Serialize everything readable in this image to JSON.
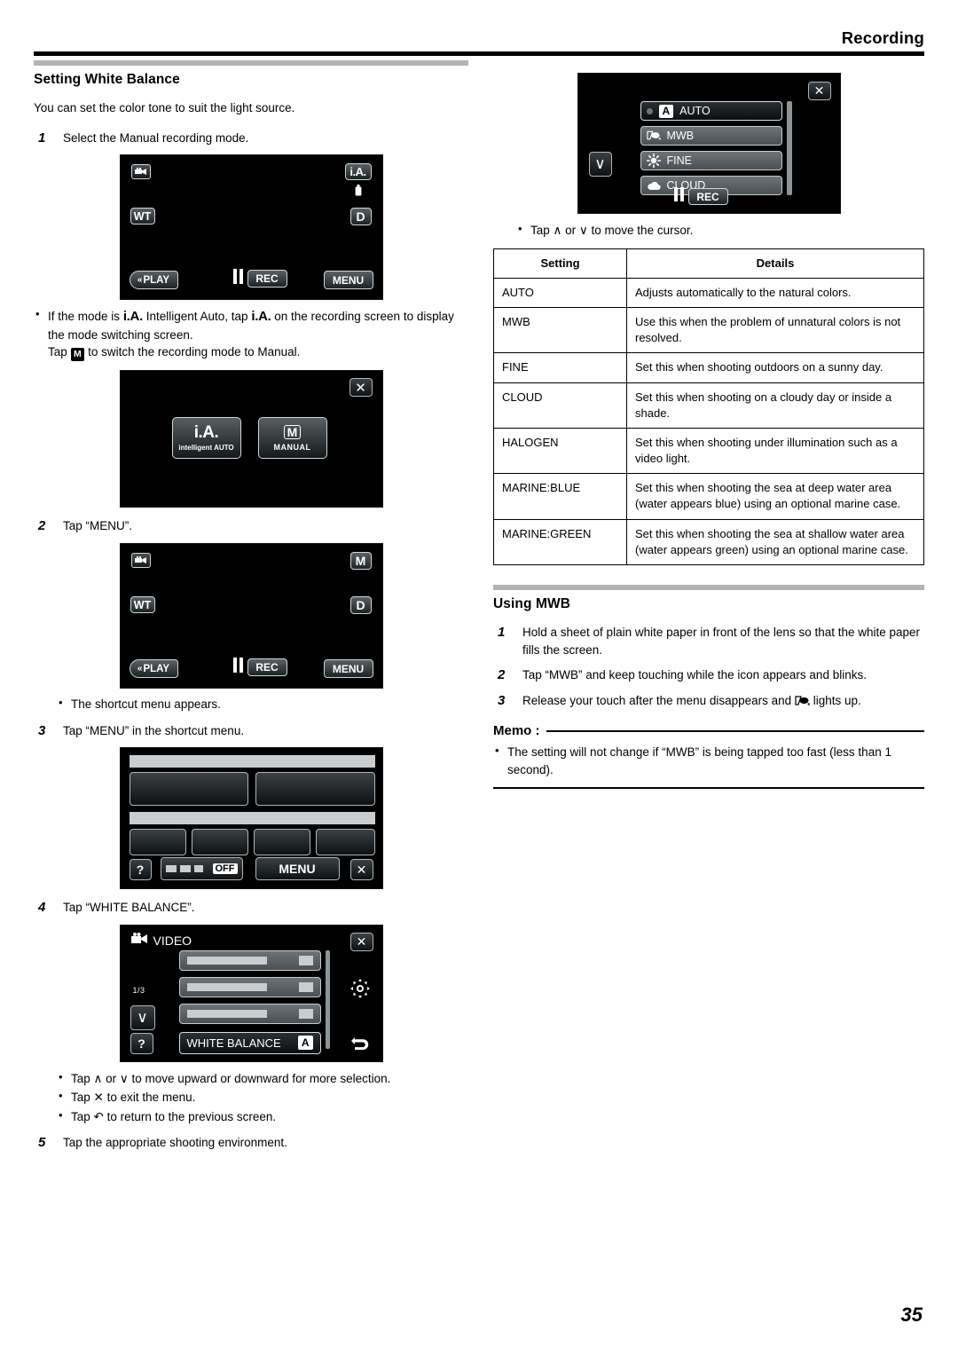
{
  "header": {
    "title": "Recording"
  },
  "page_number": "35",
  "left": {
    "section_title": "Setting White Balance",
    "intro": "You can set the color tone to suit the light source.",
    "step1": {
      "num": "1",
      "text": "Select the Manual recording mode."
    },
    "screen1": {
      "name": "recording-screen-ia",
      "camera_icon": "video-camera-icon",
      "mode_label": "i.A.",
      "zoom_label": "WT",
      "d_label": "D",
      "play_label": "PLAY",
      "rec_label": "REC",
      "menu_label": "MENU"
    },
    "note1_a": "If the mode is",
    "note1_b": "Intelligent Auto, tap",
    "note1_c": "on the recording screen to display the mode switching screen.",
    "note1_d": "Tap",
    "note1_e": "to switch the recording mode to Manual.",
    "note1_ia": "i.A.",
    "note1_m": "M",
    "screen2": {
      "name": "mode-switch-screen",
      "close_label": "✕",
      "auto_big": "i.A.",
      "auto_sub": "intelligent AUTO",
      "manual_big": "M",
      "manual_sub": "MANUAL"
    },
    "step2": {
      "num": "2",
      "text": "Tap “MENU”."
    },
    "screen3": {
      "name": "recording-screen-manual",
      "mode_label": "M",
      "zoom_label": "WT",
      "d_label": "D",
      "play_label": "PLAY",
      "rec_label": "REC",
      "menu_label": "MENU"
    },
    "note2": "The shortcut menu appears.",
    "step3": {
      "num": "3",
      "text": "Tap “MENU” in the shortcut menu."
    },
    "screen4": {
      "name": "shortcut-menu-screen",
      "help_label": "?",
      "off_label": "OFF",
      "menu_label": "MENU",
      "close_label": "✕"
    },
    "step4": {
      "num": "4",
      "text": "Tap “WHITE BALANCE”."
    },
    "screen5": {
      "name": "video-menu-screen",
      "title": "VIDEO",
      "close_label": "✕",
      "page_indicator": "1/3",
      "down_label": "∨",
      "help_label": "?",
      "white_balance_label": "WHITE BALANCE",
      "white_balance_value": "A",
      "gear_icon": "gear-icon",
      "back_icon": "back-arrow-icon"
    },
    "notes2": [
      "Tap ∧ or ∨ to move upward or downward for more selection.",
      "Tap ✕ to exit the menu.",
      "Tap ↶ to return to the previous screen."
    ],
    "step5": {
      "num": "5",
      "text": "Tap the appropriate shooting environment."
    }
  },
  "right": {
    "screen6": {
      "name": "white-balance-options-screen",
      "close_label": "✕",
      "down_label": "∨",
      "rec_label": "REC",
      "options": [
        {
          "label": "AUTO",
          "icon": "auto-a-icon",
          "selected": true
        },
        {
          "label": "MWB",
          "icon": "mwb-hand-paper-icon",
          "selected": false
        },
        {
          "label": "FINE",
          "icon": "sun-icon",
          "selected": false
        },
        {
          "label": "CLOUD",
          "icon": "cloud-icon",
          "selected": false
        }
      ]
    },
    "note_cursor": "Tap ∧ or ∨ to move the cursor.",
    "table": {
      "headers": [
        "Setting",
        "Details"
      ],
      "rows": [
        {
          "setting": "AUTO",
          "details": "Adjusts automatically to the natural colors."
        },
        {
          "setting": "MWB",
          "details": "Use this when the problem of unnatural colors is not resolved."
        },
        {
          "setting": "FINE",
          "details": "Set this when shooting outdoors on a sunny day."
        },
        {
          "setting": "CLOUD",
          "details": "Set this when shooting on a cloudy day or inside a shade."
        },
        {
          "setting": "HALOGEN",
          "details": "Set this when shooting under illumination such as a video light."
        },
        {
          "setting": "MARINE:BLUE",
          "details": "Set this when shooting the sea at deep water area (water appears blue) using an optional marine case."
        },
        {
          "setting": "MARINE:GREEN",
          "details": "Set this when shooting the sea at shallow water area (water appears green) using an optional marine case."
        }
      ]
    },
    "mwb_section_title": "Using MWB",
    "mwb_steps": [
      {
        "num": "1",
        "text": "Hold a sheet of plain white paper in front of the lens so that the white paper fills the screen."
      },
      {
        "num": "2",
        "text": "Tap “MWB” and keep touching while the icon appears and blinks."
      }
    ],
    "mwb_step3": {
      "num": "3",
      "text_a": "Release your touch after the menu disappears and",
      "text_b": "lights up.",
      "icon": "mwb-hand-paper-icon"
    },
    "memo_label": "Memo :",
    "memo_items": [
      "The setting will not change if “MWB” is being tapped too fast (less than 1 second)."
    ]
  }
}
